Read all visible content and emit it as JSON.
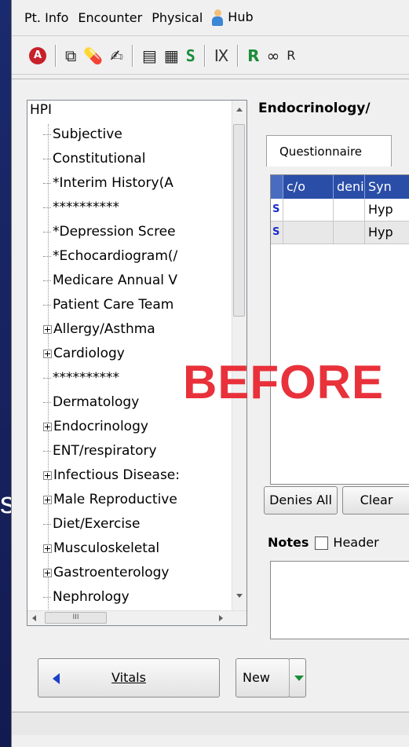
{
  "menu": {
    "items": [
      "Pt. Info",
      "Encounter",
      "Physical",
      "Hub"
    ]
  },
  "toolbar": {
    "trailing_label": "R"
  },
  "tree": {
    "items": [
      {
        "label": "HPI",
        "expandable": false,
        "root": true
      },
      {
        "label": "Subjective",
        "expandable": false
      },
      {
        "label": "Constitutional",
        "expandable": false
      },
      {
        "label": "*Interim History(A",
        "expandable": false
      },
      {
        "label": "**********",
        "expandable": false
      },
      {
        "label": "*Depression Scree",
        "expandable": false
      },
      {
        "label": "*Echocardiogram(/",
        "expandable": false
      },
      {
        "label": "Medicare Annual V",
        "expandable": false
      },
      {
        "label": "Patient Care Team",
        "expandable": false
      },
      {
        "label": "Allergy/Asthma",
        "expandable": true
      },
      {
        "label": "Cardiology",
        "expandable": true
      },
      {
        "label": "**********",
        "expandable": false
      },
      {
        "label": "Dermatology",
        "expandable": false
      },
      {
        "label": "Endocrinology",
        "expandable": true
      },
      {
        "label": "ENT/respiratory",
        "expandable": false
      },
      {
        "label": "Infectious Disease:",
        "expandable": true
      },
      {
        "label": "Male Reproductive",
        "expandable": true
      },
      {
        "label": "Diet/Exercise",
        "expandable": false
      },
      {
        "label": "Musculoskeletal",
        "expandable": true
      },
      {
        "label": "Gastroenterology",
        "expandable": true
      },
      {
        "label": "Nephrology",
        "expandable": false
      }
    ],
    "hscroll_grip": "III"
  },
  "panel": {
    "title": "Endocrinology/",
    "tab_label": "Questionnaire",
    "grid": {
      "columns": [
        "",
        "c/o",
        "denie",
        "Syn"
      ],
      "rows": [
        {
          "flag": "S",
          "co": "",
          "denies": "",
          "symptom": "Hyp"
        },
        {
          "flag": "S",
          "co": "",
          "denies": "",
          "symptom": "Hyp"
        }
      ]
    },
    "denies_all_label": "Denies All",
    "clear_label": "Clear",
    "notes_label": "Notes",
    "header_label": "Header"
  },
  "overlay": {
    "before_label": "BEFORE",
    "edge_letter": "s"
  },
  "footer": {
    "vitals_label": "Vitals",
    "new_label": "New"
  },
  "colors": {
    "grid_header": "#2a4da8",
    "overlay_text": "#e8313a",
    "background": "#1a2a6e"
  }
}
